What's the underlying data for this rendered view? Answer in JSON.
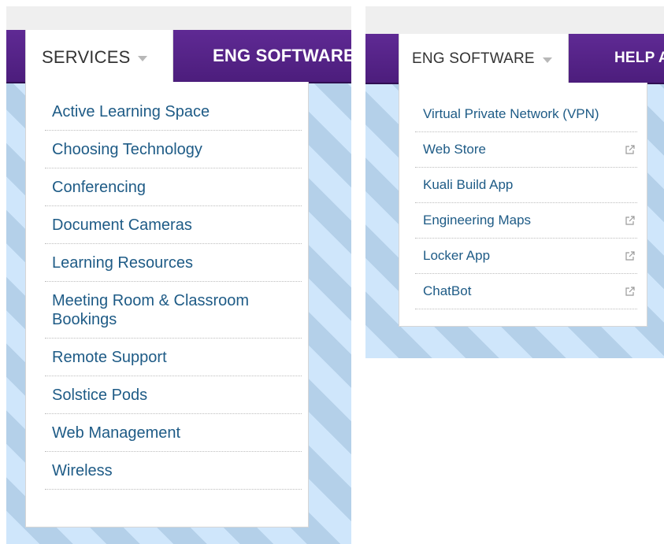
{
  "left": {
    "nav": {
      "active": "SERVICES",
      "next": "ENG SOFTWARE"
    },
    "menu": [
      {
        "label": "Active Learning Space"
      },
      {
        "label": "Choosing Technology"
      },
      {
        "label": "Conferencing"
      },
      {
        "label": "Document Cameras"
      },
      {
        "label": "Learning Resources"
      },
      {
        "label": "Meeting Room & Classroom Bookings"
      },
      {
        "label": "Remote Support"
      },
      {
        "label": "Solstice Pods"
      },
      {
        "label": "Web Management"
      },
      {
        "label": "Wireless"
      }
    ]
  },
  "right": {
    "nav": {
      "active": "ENG SOFTWARE",
      "next": "HELP A"
    },
    "menu": [
      {
        "label": "Virtual Private Network (VPN)",
        "icon": null
      },
      {
        "label": "Web Store",
        "icon": "external-link-icon"
      },
      {
        "label": "Kuali Build App",
        "icon": null
      },
      {
        "label": "Engineering Maps",
        "icon": "external-link-icon"
      },
      {
        "label": "Locker App",
        "icon": "external-link-icon"
      },
      {
        "label": "ChatBot",
        "icon": "external-link-icon"
      }
    ]
  },
  "colors": {
    "nav_purple": "#4f1f82",
    "link_blue": "#1e5b86",
    "stripe_light": "#cfe6fb",
    "stripe_dark": "#b4d0e9"
  }
}
